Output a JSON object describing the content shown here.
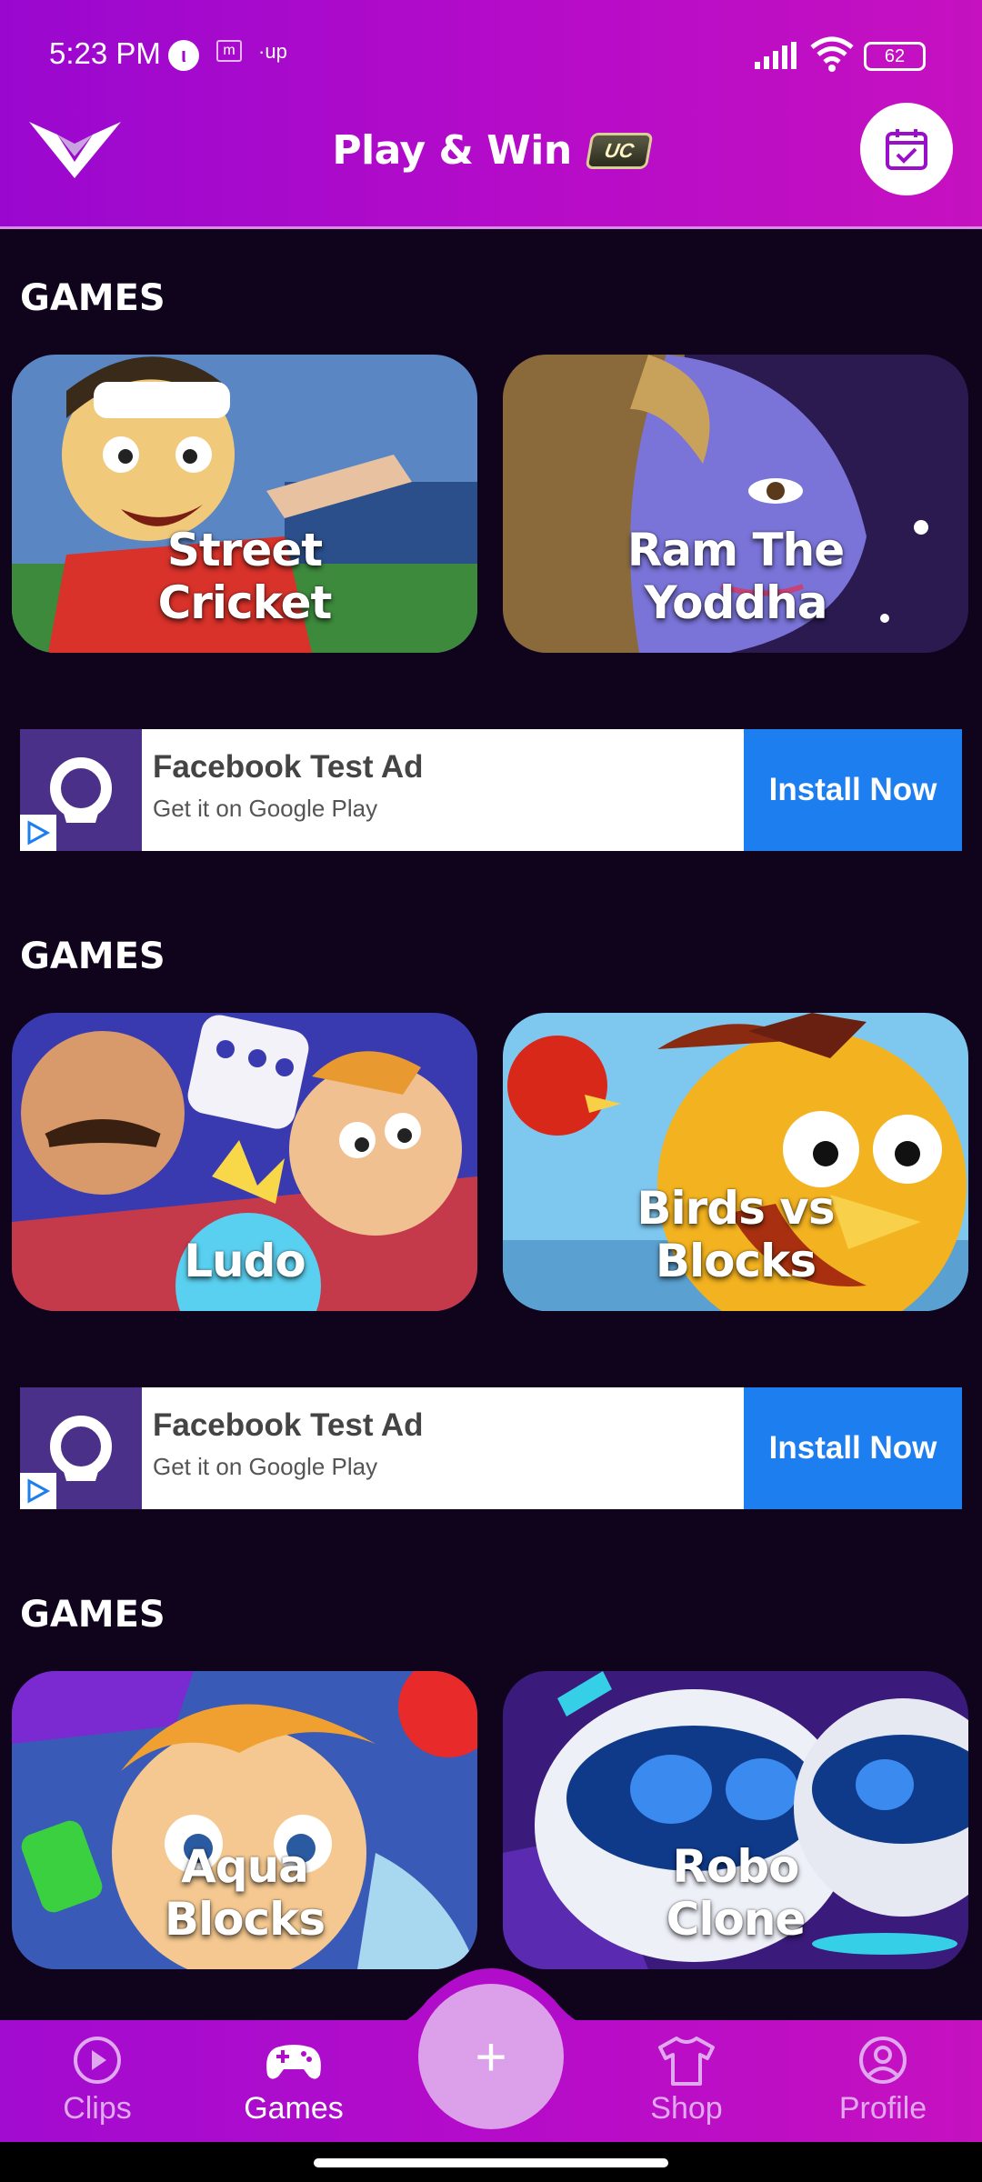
{
  "status_bar": {
    "time": "5:23 PM",
    "battery": "62",
    "up_label": "up",
    "m_label": "m"
  },
  "header": {
    "title": "Play & Win",
    "badge": "UC"
  },
  "sections": [
    {
      "heading": "GAMES",
      "games": [
        {
          "label": "Street\nCricket"
        },
        {
          "label": "Ram The\nYoddha"
        }
      ]
    },
    {
      "heading": "GAMES",
      "games": [
        {
          "label": "Ludo"
        },
        {
          "label": "Birds vs\nBlocks"
        }
      ]
    },
    {
      "heading": "GAMES",
      "games": [
        {
          "label": "Aqua\nBlocks"
        },
        {
          "label": "Robo\nClone"
        }
      ]
    }
  ],
  "ads": [
    {
      "title": "Facebook Test Ad",
      "subtitle": "Get it on Google Play",
      "cta": "Install Now"
    },
    {
      "title": "Facebook Test Ad",
      "subtitle": "Get it on Google Play",
      "cta": "Install Now"
    }
  ],
  "nav": {
    "items": [
      {
        "label": "Clips",
        "icon": "play-circle-icon"
      },
      {
        "label": "Games",
        "icon": "gamepad-icon"
      },
      {
        "label": "Shop",
        "icon": "tshirt-icon"
      },
      {
        "label": "Profile",
        "icon": "user-circle-icon"
      }
    ],
    "fab": "+",
    "active": "Games"
  },
  "colors": {
    "header": "#b80cc8",
    "background": "#10031c",
    "cta": "#1d7ef0",
    "fab": "#dc9fe9"
  }
}
